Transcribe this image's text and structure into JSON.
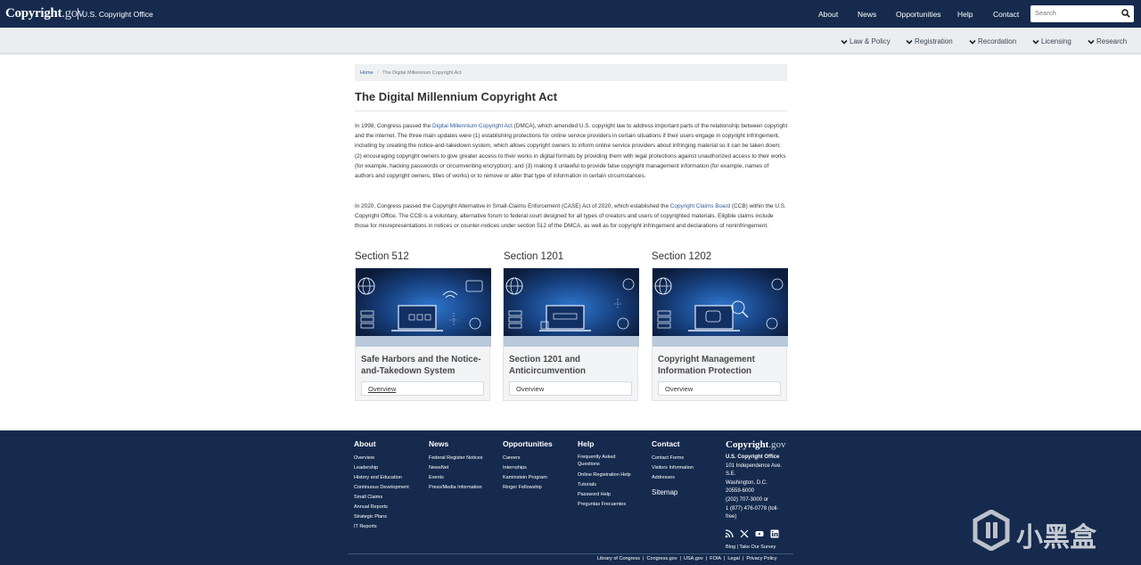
{
  "header": {
    "logo_bold": "Copyright",
    "logo_gov": ".gov",
    "logo_sub": "U.S. Copyright Office",
    "nav": [
      "About",
      "News",
      "Opportunities",
      "Help",
      "Contact"
    ],
    "search_placeholder": "Search"
  },
  "subnav": [
    "Law & Policy",
    "Registration",
    "Recordation",
    "Licensing",
    "Research"
  ],
  "breadcrumb": {
    "home": "Home",
    "separator": "/",
    "current": "The Digital Millennium Copyright Act"
  },
  "page_title": "The Digital Millennium Copyright Act",
  "para1": {
    "before_link": "In 1998, Congress passed the ",
    "link": "Digital Millennium Copyright Act",
    "after_link": " (DMCA), which amended U.S. copyright law to address important parts of the relationship between copyright and the internet. The three main updates were (1) establishing protections for online service providers in certain situations if their users engage in copyright infringement, including by creating the notice-and-takedown system, which allows copyright owners to inform online service providers about infringing material so it can be taken down; (2) encouraging copyright owners to give greater access to their works in digital formats by providing them with legal protections against unauthorized access to their works (for example, hacking passwords or circumventing encryption); and (3) making it unlawful to provide false copyright management information (for example, names of authors and copyright owners, titles of works) or to remove or alter that type of information in certain circumstances."
  },
  "para2": {
    "before_link": "In 2020, Congress passed the Copyright Alternative in Small-Claims Enforcement (CASE) Act of 2020, which established the ",
    "link": "Copyright Claims Board",
    "after_link": " (CCB) within the U.S. Copyright Office. The CCB is a voluntary, alternative forum to federal court designed for all types of creators and users of copyrighted materials. Eligible claims include those for misrepresentations in notices or counter-notices under section 512 of the DMCA, as well as for copyright infringement and declarations of noninfringement."
  },
  "cards": [
    {
      "heading": "Section 512",
      "title": "Safe Harbors and the Notice-and-Takedown System",
      "button": "Overview"
    },
    {
      "heading": "Section 1201",
      "title": "Section 1201 and Anticircumvention",
      "button": "Overview"
    },
    {
      "heading": "Section 1202",
      "title": "Copyright Management Information Protection",
      "button": "Overview"
    }
  ],
  "footer": {
    "about": {
      "title": "About",
      "links": [
        "Overview",
        "Leadership",
        "History and Education",
        "Continuous Development",
        "Small Claims",
        "Annual Reports",
        "Strategic Plans",
        "IT Reports"
      ]
    },
    "news": {
      "title": "News",
      "links": [
        "Federal Register Notices",
        "NewsNet",
        "Events",
        "Press/Media Information"
      ]
    },
    "opportunities": {
      "title": "Opportunities",
      "links": [
        "Careers",
        "Internships",
        "Kaminstein Program",
        "Ringer Fellowship"
      ]
    },
    "help": {
      "title": "Help",
      "links": [
        "Frequently Asked",
        "Questions",
        "Online Registration Help",
        "Tutorials",
        "Password Help",
        "Preguntas Frecuentes"
      ]
    },
    "contact": {
      "title": "Contact",
      "links": [
        "Contact Forms",
        "Visitors Information",
        "Addresses"
      ],
      "sitemap": "Sitemap"
    },
    "office": {
      "logo_bold": "Copyright",
      "logo_gov": ".gov",
      "name": "U.S. Copyright Office",
      "address_lines": [
        "101 Independence Ave.",
        "S.E.",
        "Washington, D.C.",
        "20559-6000",
        "(202) 707-3000 or",
        "1 (877) 476-0778 (toll-",
        "free)"
      ]
    },
    "blog_line": "Blog | Take Our Survey",
    "bottom_links": "Library of Congress  |  Congress.gov  |  USA.gov  |  FOIA  |  Legal  |  Privacy Policy"
  },
  "watermark_text": "小黑盒"
}
